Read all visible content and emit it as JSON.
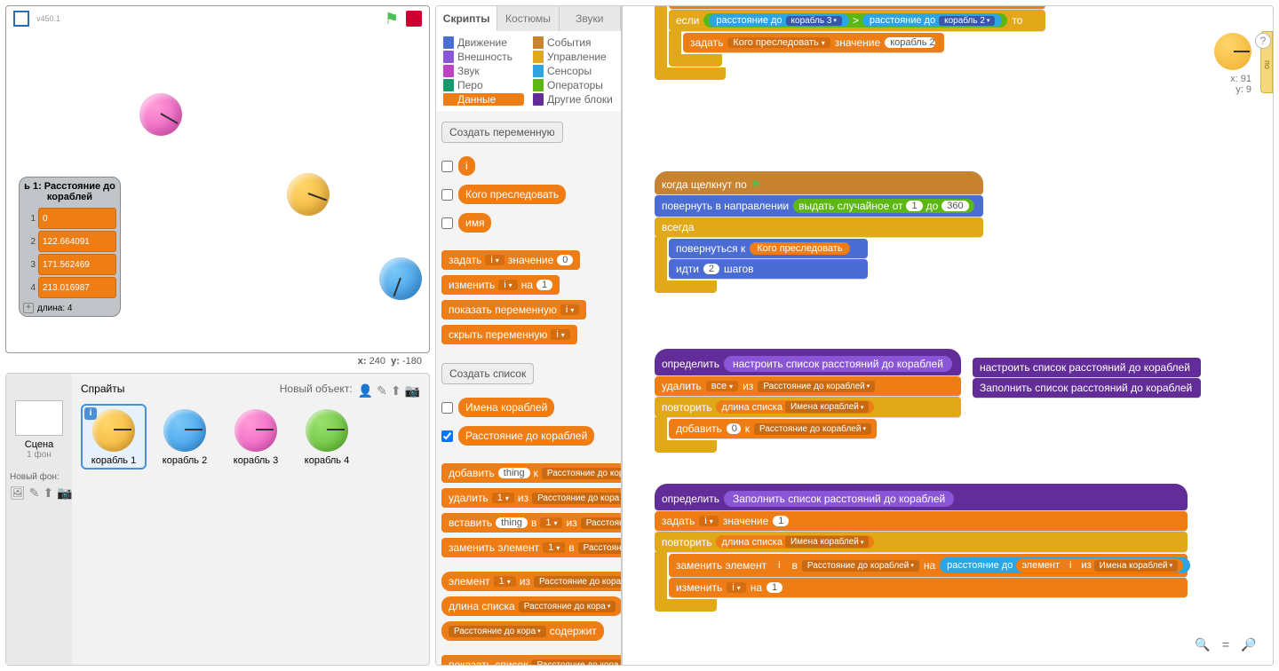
{
  "version": "v450.1",
  "stage_coords": {
    "x_label": "x:",
    "x": "240",
    "y_label": "y:",
    "y": "-180"
  },
  "list_monitor": {
    "title": "ь 1: Расстояние до кораблей",
    "rows": [
      {
        "idx": "1",
        "val": "0"
      },
      {
        "idx": "2",
        "val": "122.664091"
      },
      {
        "idx": "3",
        "val": "171.562469"
      },
      {
        "idx": "4",
        "val": "213.016987"
      }
    ],
    "length_label": "длина: 4"
  },
  "sprites": {
    "header": "Спрайты",
    "new_object": "Новый объект:",
    "scene_label": "Сцена",
    "scene_sub": "1 фон",
    "new_bg": "Новый фон:",
    "tiles": [
      {
        "name": "корабль 1",
        "color": "or",
        "selected": true
      },
      {
        "name": "корабль 2",
        "color": "bl"
      },
      {
        "name": "корабль 3",
        "color": "pk"
      },
      {
        "name": "корабль 4",
        "color": "gr"
      }
    ]
  },
  "tabs": {
    "scripts": "Скрипты",
    "costumes": "Костюмы",
    "sounds": "Звуки"
  },
  "categories": {
    "motion": "Движение",
    "events": "События",
    "looks": "Внешность",
    "control": "Управление",
    "sound": "Звук",
    "sensing": "Сенсоры",
    "pen": "Перо",
    "operators": "Операторы",
    "data": "Данные",
    "more": "Другие блоки"
  },
  "palette": {
    "make_var": "Создать переменную",
    "vars": {
      "i": "i",
      "who": "Кого преследовать",
      "name": "имя"
    },
    "set_var": "задать",
    "value_word": "значение",
    "zero": "0",
    "change_var": "изменить",
    "by_word": "на",
    "one": "1",
    "show_var": "показать переменную",
    "hide_var": "скрыть переменную",
    "make_list": "Создать список",
    "lists": {
      "names": "Имена кораблей",
      "dist": "Расстояние до кораблей"
    },
    "add": "добавить",
    "thing": "thing",
    "to": "к",
    "delete": "удалить",
    "of": "из",
    "one_dd": "1",
    "insert": "вставить",
    "in": "в",
    "replace": "заменить элемент",
    "item": "элемент",
    "length": "длина списка",
    "contains": "содержит",
    "show_list": "показать список",
    "dist_short": "Расстояние до кора"
  },
  "scripts": {
    "set": "задать",
    "who_var": "Кого преследовать",
    "value": "значение",
    "ship3": "корабль 3",
    "ship2": "корабль 2",
    "if": "если",
    "then": "то",
    "distance_to": "расстояние до",
    "gt": ">",
    "when_clicked": "когда щелкнут по",
    "point_dir": "повернуть в направлении",
    "random": "выдать случайное от",
    "r1": "1",
    "to_word": "до",
    "r360": "360",
    "forever": "всегда",
    "point_towards": "повернуться к",
    "move": "идти",
    "steps": "шагов",
    "two": "2",
    "define": "определить",
    "setup_list": "настроить список расстояний до кораблей",
    "fill_list": "Заполнить список расстояний до кораблей",
    "delete_all": "удалить",
    "all": "все",
    "from": "из",
    "repeat": "повторить",
    "length_of": "длина списка",
    "names_list": "Имена кораблей",
    "dist_list": "Расстояние до кораблей",
    "add_word": "добавить",
    "zero_v": "0",
    "to_k": "к",
    "set_i": "задать",
    "i_var": "i",
    "val1": "1",
    "replace_item": "заменить элемент",
    "in_word": "в",
    "with_word": "на",
    "item_word": "элемент",
    "of_word": "из",
    "change_i": "изменить",
    "by1": "1"
  },
  "preview": {
    "x_label": "x:",
    "x": "91",
    "y_label": "y:",
    "y": "9"
  },
  "help_tab": "по"
}
